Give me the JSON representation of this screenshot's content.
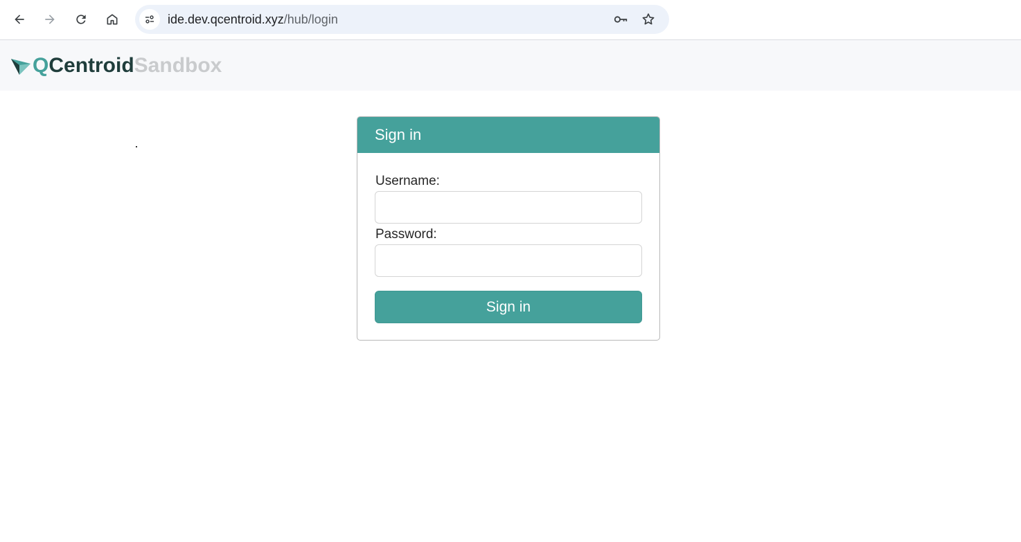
{
  "browser": {
    "url_host": "ide.dev.qcentroid.xyz",
    "url_path": "/hub/login",
    "icons": [
      "back-arrow-icon",
      "forward-arrow-icon",
      "reload-icon",
      "home-icon",
      "site-info-icon",
      "password-key-icon",
      "bookmark-star-icon"
    ]
  },
  "header": {
    "logo_q": "Q",
    "logo_main": "Centroid",
    "logo_suffix": "Sandbox"
  },
  "login": {
    "title": "Sign in",
    "username_label": "Username:",
    "username_value": "",
    "password_label": "Password:",
    "password_value": "",
    "submit_label": "Sign in"
  },
  "colors": {
    "accent": "#45a19b",
    "logo_dark": "#1f3d3b",
    "logo_light": "#c9cbcd"
  }
}
